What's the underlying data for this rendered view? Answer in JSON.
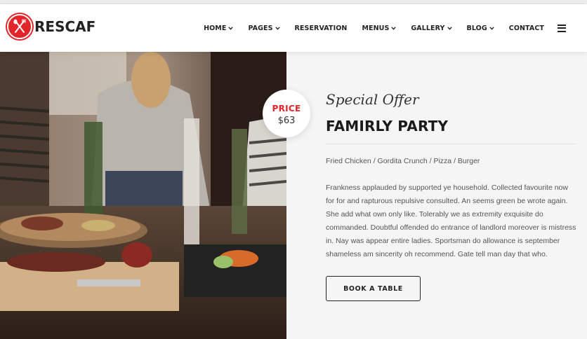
{
  "brand": {
    "name": "RESCAF",
    "accent": "#e1252b"
  },
  "nav": {
    "items": [
      {
        "label": "HOME",
        "dropdown": true
      },
      {
        "label": "PAGES",
        "dropdown": true
      },
      {
        "label": "RESERVATION",
        "dropdown": false
      },
      {
        "label": "MENUS",
        "dropdown": true
      },
      {
        "label": "GALLERY",
        "dropdown": true
      },
      {
        "label": "BLOG",
        "dropdown": true
      },
      {
        "label": "CONTACT",
        "dropdown": false
      }
    ]
  },
  "price": {
    "label": "PRICE",
    "value": "$63"
  },
  "offer": {
    "subtitle": "Special Offer",
    "title": "FAMIRLY PARTY",
    "items": "Fried Chicken / Gordita Crunch / Pizza / Burger",
    "description": "Frankness applauded by supported ye household. Collected favourite now for for and rapturous repulsive consulted. An seems green be wrote again. She add what own only like. Tolerably we as extremity exquisite do commanded. Doubtful offended do entrance of landlord moreover is mistress in. Nay was appear entire ladies. Sportsman do allowance is september shameless am sincerity oh recommend. Gate tell man day that who.",
    "button_label": "BOOK A TABLE"
  }
}
